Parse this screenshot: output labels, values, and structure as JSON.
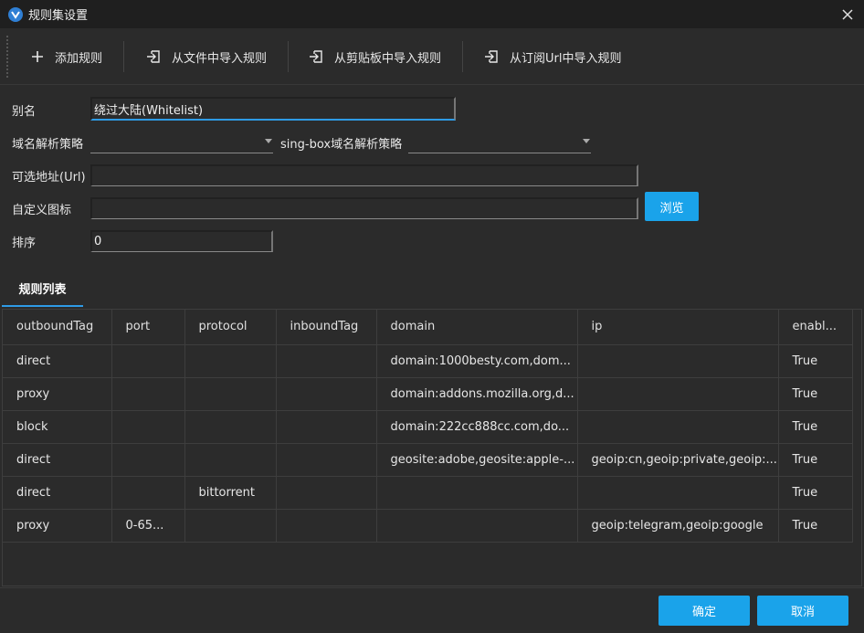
{
  "window": {
    "title": "规则集设置"
  },
  "toolbar": {
    "add_rule": "添加规则",
    "import_file": "从文件中导入规则",
    "import_clipboard": "从剪贴板中导入规则",
    "import_url": "从订阅Url中导入规则"
  },
  "form": {
    "alias_label": "别名",
    "alias_value": "绕过大陆(Whitelist)",
    "domain_strategy_label": "域名解析策略",
    "domain_strategy_value": "",
    "singbox_strategy_label": "sing-box域名解析策略",
    "singbox_strategy_value": "",
    "url_label": "可选地址(Url)",
    "url_value": "",
    "icon_label": "自定义图标",
    "icon_value": "",
    "browse_button": "浏览",
    "sort_label": "排序",
    "sort_value": "0"
  },
  "tabs": {
    "rules_list": "规则列表"
  },
  "table": {
    "columns": [
      "outboundTag",
      "port",
      "protocol",
      "inboundTag",
      "domain",
      "ip",
      "enabl..."
    ],
    "rows": [
      [
        "direct",
        "",
        "",
        "",
        "domain:1000besty.com,dom...",
        "",
        "True"
      ],
      [
        "proxy",
        "",
        "",
        "",
        "domain:addons.mozilla.org,d...",
        "",
        "True"
      ],
      [
        "block",
        "",
        "",
        "",
        "domain:222cc888cc.com,do...",
        "",
        "True"
      ],
      [
        "direct",
        "",
        "",
        "",
        "geosite:adobe,geosite:apple-...",
        "geoip:cn,geoip:private,geoip:...",
        "True"
      ],
      [
        "direct",
        "",
        "bittorrent",
        "",
        "",
        "",
        "True"
      ],
      [
        "proxy",
        "0-65...",
        "",
        "",
        "",
        "geoip:telegram,geoip:google",
        "True"
      ]
    ]
  },
  "footer": {
    "ok_button": "确定",
    "cancel_button": "取消"
  },
  "colors": {
    "accent": "#1aa3ea",
    "background": "#2b2b2b",
    "titlebar": "#1f1f1f"
  }
}
